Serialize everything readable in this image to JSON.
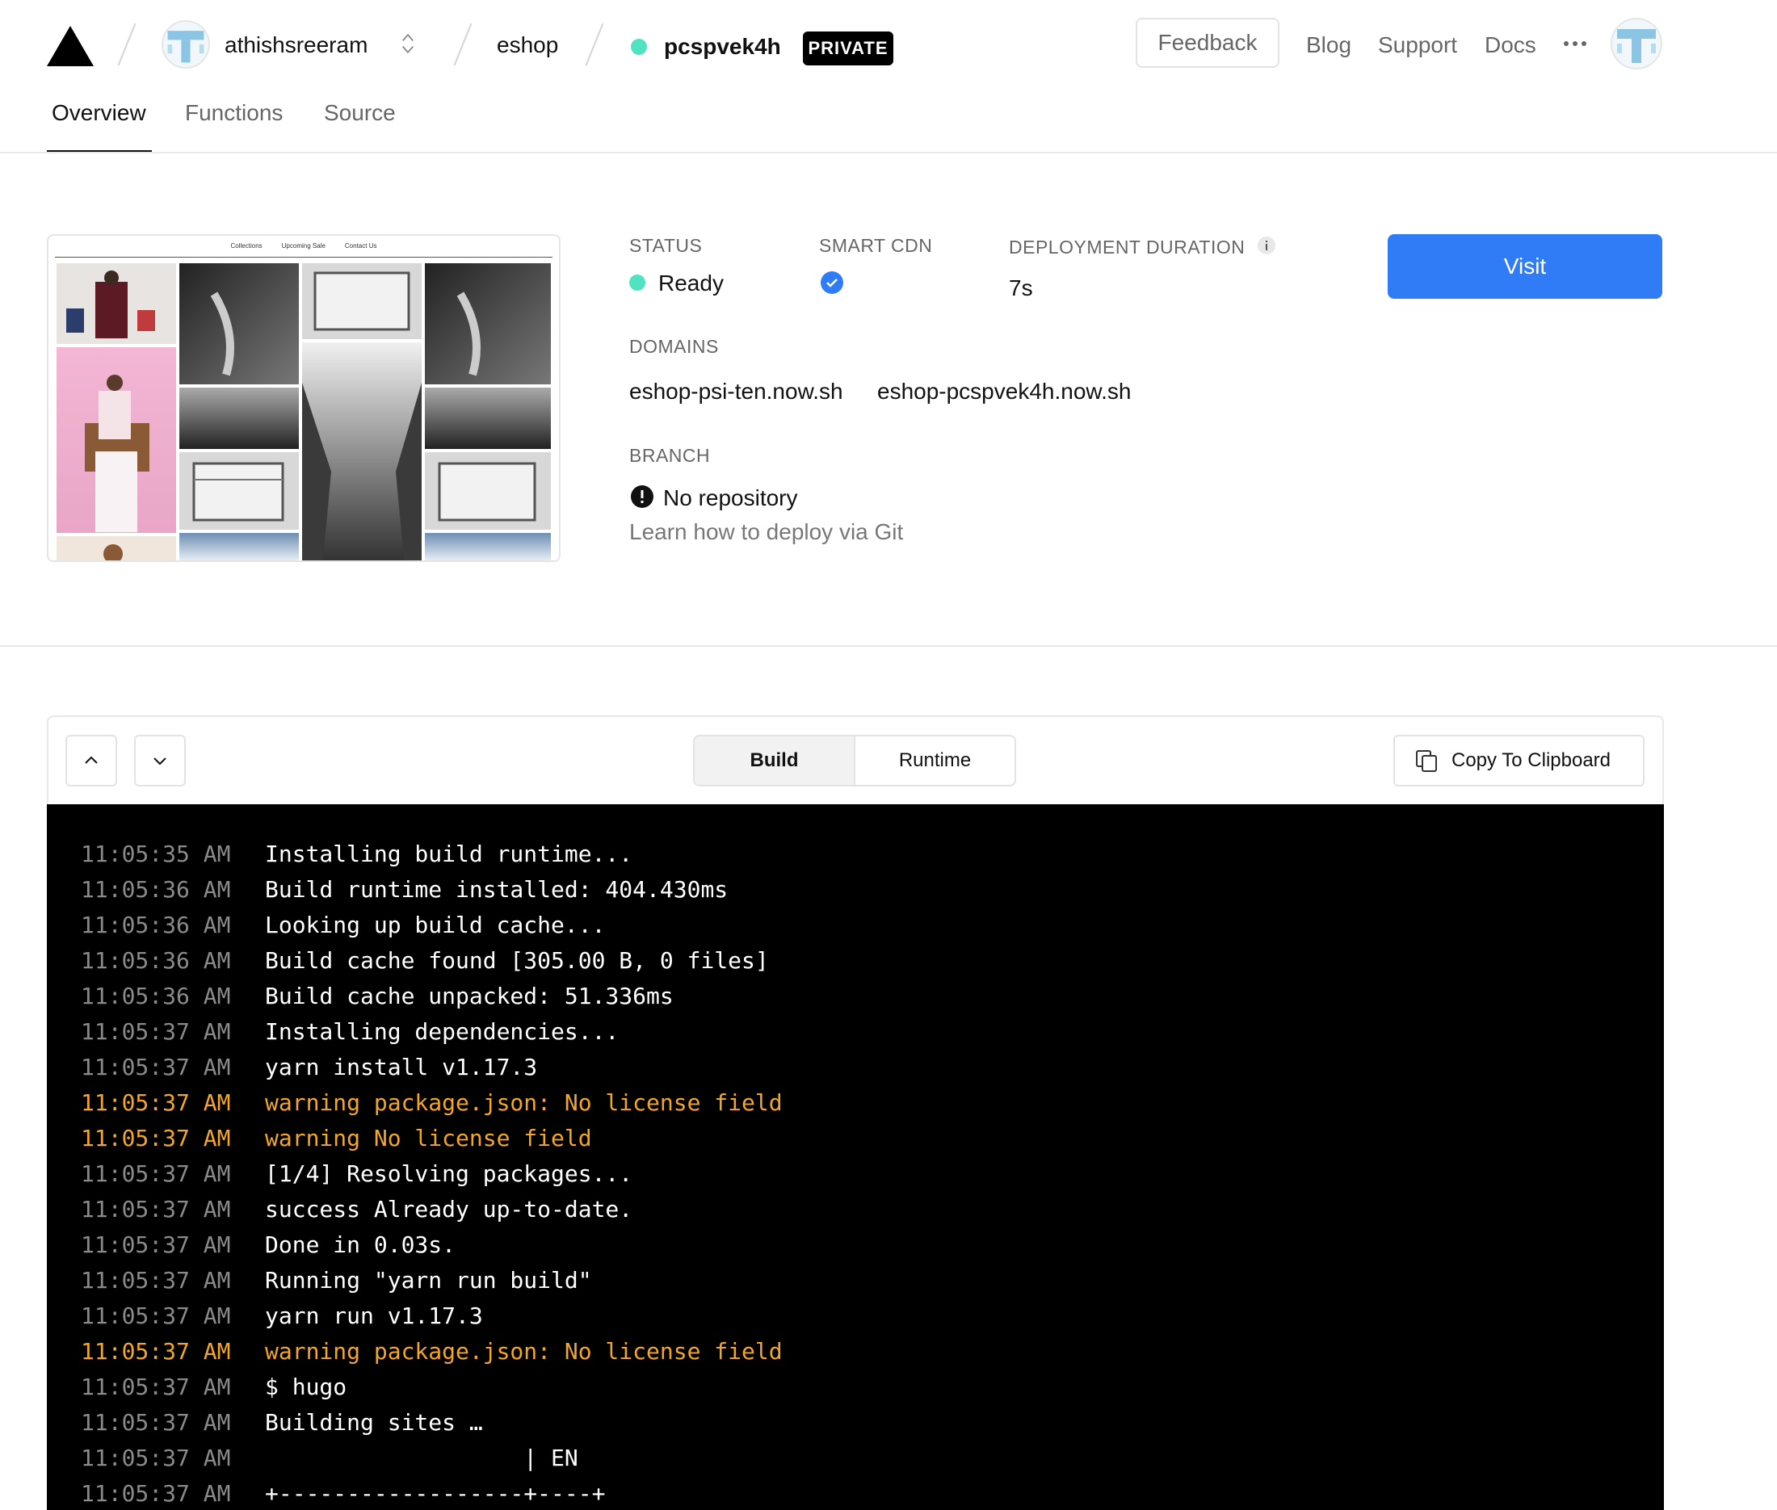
{
  "header": {
    "team_name": "athishsreeram",
    "project_name": "eshop",
    "deployment_id": "pcspvek4h",
    "visibility_badge": "PRIVATE",
    "feedback_label": "Feedback",
    "links": [
      "Blog",
      "Support",
      "Docs"
    ],
    "status_color": "#50e3c2"
  },
  "tabs": [
    "Overview",
    "Functions",
    "Source"
  ],
  "active_tab": "Overview",
  "overview": {
    "preview_nav": [
      "Collections",
      "Upcoming Sale",
      "Contact Us"
    ],
    "status_label": "STATUS",
    "status_value": "Ready",
    "smart_cdn_label": "SMART CDN",
    "duration_label": "DEPLOYMENT DURATION",
    "duration_value": "7s",
    "domains_label": "DOMAINS",
    "domains": [
      "eshop-psi-ten.now.sh",
      "eshop-pcspvek4h.now.sh"
    ],
    "branch_label": "BRANCH",
    "branch_value": "No repository",
    "branch_help": "Learn how to deploy via Git",
    "visit_label": "Visit",
    "accent_color": "#2f7cf6"
  },
  "logs": {
    "segments": [
      "Build",
      "Runtime"
    ],
    "selected_segment": "Build",
    "copy_label": "Copy To Clipboard",
    "warning_color": "#f5a623",
    "lines": [
      {
        "time": "11:05:35 AM",
        "msg": "Installing build runtime...",
        "level": "info"
      },
      {
        "time": "11:05:36 AM",
        "msg": "Build runtime installed: 404.430ms",
        "level": "info"
      },
      {
        "time": "11:05:36 AM",
        "msg": "Looking up build cache...",
        "level": "info"
      },
      {
        "time": "11:05:36 AM",
        "msg": "Build cache found [305.00 B, 0 files]",
        "level": "info"
      },
      {
        "time": "11:05:36 AM",
        "msg": "Build cache unpacked: 51.336ms",
        "level": "info"
      },
      {
        "time": "11:05:37 AM",
        "msg": "Installing dependencies...",
        "level": "info"
      },
      {
        "time": "11:05:37 AM",
        "msg": "yarn install v1.17.3",
        "level": "info"
      },
      {
        "time": "11:05:37 AM",
        "msg": "warning package.json: No license field",
        "level": "warning"
      },
      {
        "time": "11:05:37 AM",
        "msg": "warning No license field",
        "level": "warning"
      },
      {
        "time": "11:05:37 AM",
        "msg": "[1/4] Resolving packages...",
        "level": "info"
      },
      {
        "time": "11:05:37 AM",
        "msg": "success Already up-to-date.",
        "level": "info"
      },
      {
        "time": "11:05:37 AM",
        "msg": "Done in 0.03s.",
        "level": "info"
      },
      {
        "time": "11:05:37 AM",
        "msg": "Running \"yarn run build\"",
        "level": "info"
      },
      {
        "time": "11:05:37 AM",
        "msg": "yarn run v1.17.3",
        "level": "info"
      },
      {
        "time": "11:05:37 AM",
        "msg": "warning package.json: No license field",
        "level": "warning"
      },
      {
        "time": "11:05:37 AM",
        "msg": "$ hugo",
        "level": "info"
      },
      {
        "time": "11:05:37 AM",
        "msg": "Building sites …",
        "level": "info"
      },
      {
        "time": "11:05:37 AM",
        "msg": "                   | EN",
        "level": "info"
      },
      {
        "time": "11:05:37 AM",
        "msg": "+------------------+----+",
        "level": "info"
      }
    ]
  }
}
